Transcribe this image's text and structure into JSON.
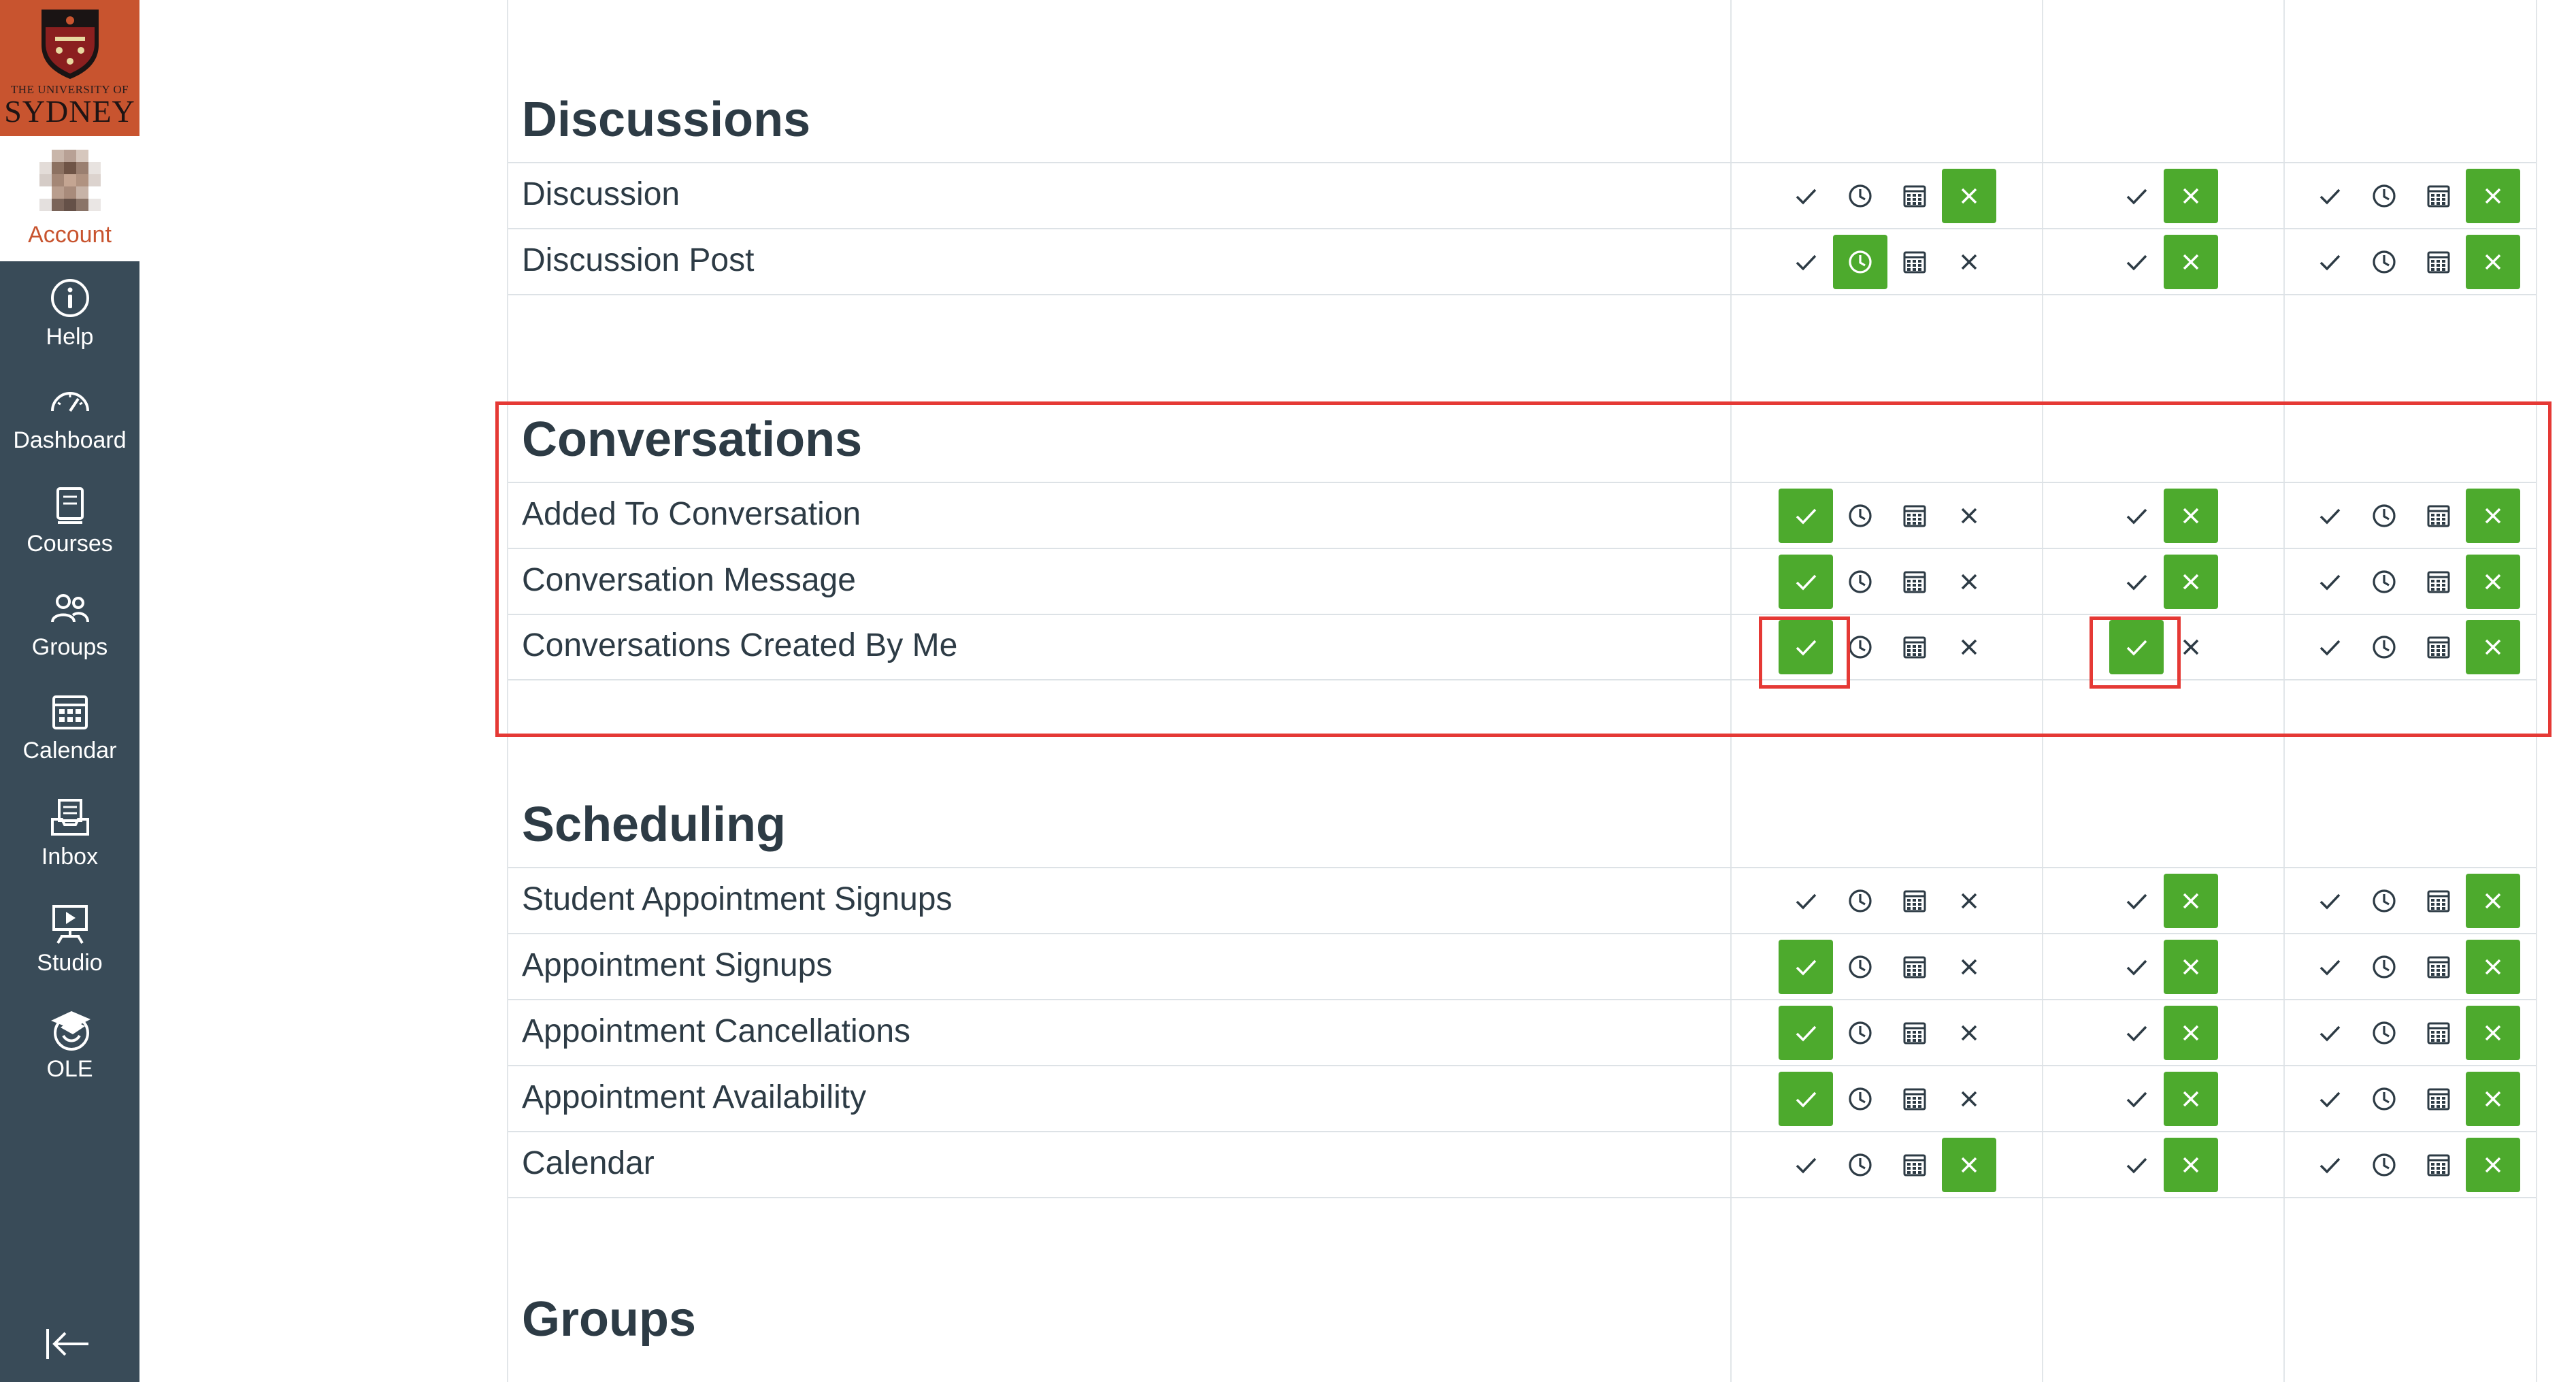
{
  "nav": {
    "logo_small": "THE UNIVERSITY OF",
    "logo_big": "SYDNEY",
    "account_label": "Account",
    "items": [
      {
        "label": "Help",
        "icon": "help-icon"
      },
      {
        "label": "Dashboard",
        "icon": "dashboard-icon"
      },
      {
        "label": "Courses",
        "icon": "courses-icon"
      },
      {
        "label": "Groups",
        "icon": "groups-icon"
      },
      {
        "label": "Calendar",
        "icon": "calendar-icon"
      },
      {
        "label": "Inbox",
        "icon": "inbox-icon"
      },
      {
        "label": "Studio",
        "icon": "studio-icon"
      },
      {
        "label": "OLE",
        "icon": "ole-icon"
      }
    ],
    "collapse_icon": "collapse-nav-icon"
  },
  "colors": {
    "nav_bg": "#394b58",
    "brand": "#c8542f",
    "selected": "#4daa2d",
    "highlight": "#e53935"
  },
  "option_icons": [
    "checkmark-icon",
    "clock-icon",
    "calendar-icon",
    "close-icon"
  ],
  "sections": [
    {
      "title": "Discussions",
      "rows": [
        {
          "label": "Discussion",
          "selected": [
            "close",
            "close",
            "close"
          ]
        },
        {
          "label": "Discussion Post",
          "selected": [
            "clock",
            "close",
            "close"
          ]
        }
      ]
    },
    {
      "title": "Conversations",
      "rows": [
        {
          "label": "Added To Conversation",
          "selected": [
            "check",
            "close",
            "close"
          ]
        },
        {
          "label": "Conversation Message",
          "selected": [
            "check",
            "close",
            "close"
          ]
        },
        {
          "label": "Conversations Created By Me",
          "selected": [
            "check",
            "check",
            "close"
          ]
        }
      ]
    },
    {
      "title": "Scheduling",
      "rows": [
        {
          "label": "Student Appointment Signups",
          "selected": [
            "none",
            "close",
            "close"
          ]
        },
        {
          "label": "Appointment Signups",
          "selected": [
            "check",
            "close",
            "close"
          ]
        },
        {
          "label": "Appointment Cancellations",
          "selected": [
            "check",
            "close",
            "close"
          ]
        },
        {
          "label": "Appointment Availability",
          "selected": [
            "check",
            "close",
            "close"
          ]
        },
        {
          "label": "Calendar",
          "selected": [
            "close",
            "close",
            "close"
          ]
        }
      ]
    },
    {
      "title": "Groups",
      "rows": []
    }
  ]
}
